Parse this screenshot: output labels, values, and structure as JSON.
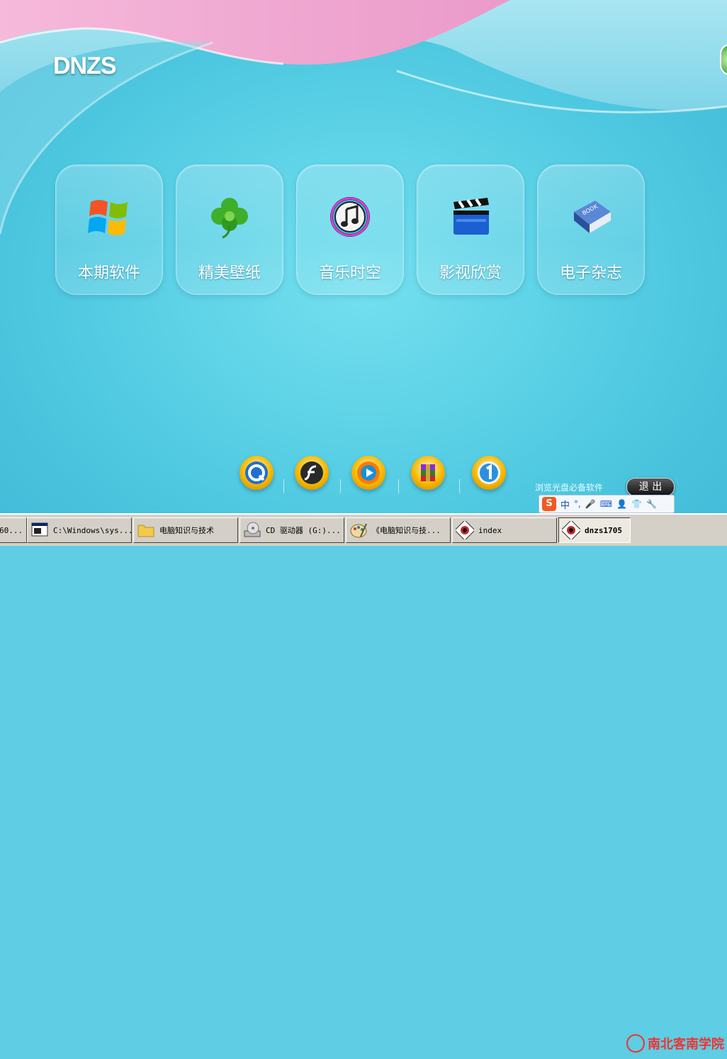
{
  "app": {
    "logo": "DNZS",
    "tiles": [
      {
        "label": "本期软件",
        "icon": "windows-logo-icon"
      },
      {
        "label": "精美壁纸",
        "icon": "clover-icon"
      },
      {
        "label": "音乐时空",
        "icon": "music-note-icon"
      },
      {
        "label": "影视欣赏",
        "icon": "clapperboard-icon"
      },
      {
        "label": "电子杂志",
        "icon": "book-icon"
      }
    ],
    "tools": [
      {
        "icon": "quicktime-icon"
      },
      {
        "icon": "flash-player-icon"
      },
      {
        "icon": "media-player-icon"
      },
      {
        "icon": "winrar-icon"
      },
      {
        "icon": "one-key-icon"
      }
    ],
    "essential_label": "浏览光盘必备软件",
    "exit_label": "退 出",
    "ime": {
      "mode": "中",
      "punct": "°,",
      "logo": "S"
    }
  },
  "taskbar": {
    "items": [
      {
        "label": "60...",
        "active": false
      },
      {
        "label": "C:\\Windows\\sys...",
        "active": false,
        "icon": "console-icon"
      },
      {
        "label": "电脑知识与技术",
        "active": false,
        "icon": "folder-icon"
      },
      {
        "label": "CD 驱动器 (G:)...",
        "active": false,
        "icon": "cd-drive-icon"
      },
      {
        "label": "《电脑知识与技...",
        "active": false,
        "icon": "paint-icon"
      },
      {
        "label": "index",
        "active": false,
        "icon": "dnzs-app-icon"
      },
      {
        "label": "dnzs1705",
        "active": true,
        "icon": "dnzs-app-icon"
      }
    ],
    "watermark": "南北客南学院"
  },
  "colors": {
    "bg_blue": "#4fc9e1",
    "pink_wave": "#ee9fcb",
    "taskbar": "#d4d0c8",
    "tool_gold": "#f6b900"
  }
}
